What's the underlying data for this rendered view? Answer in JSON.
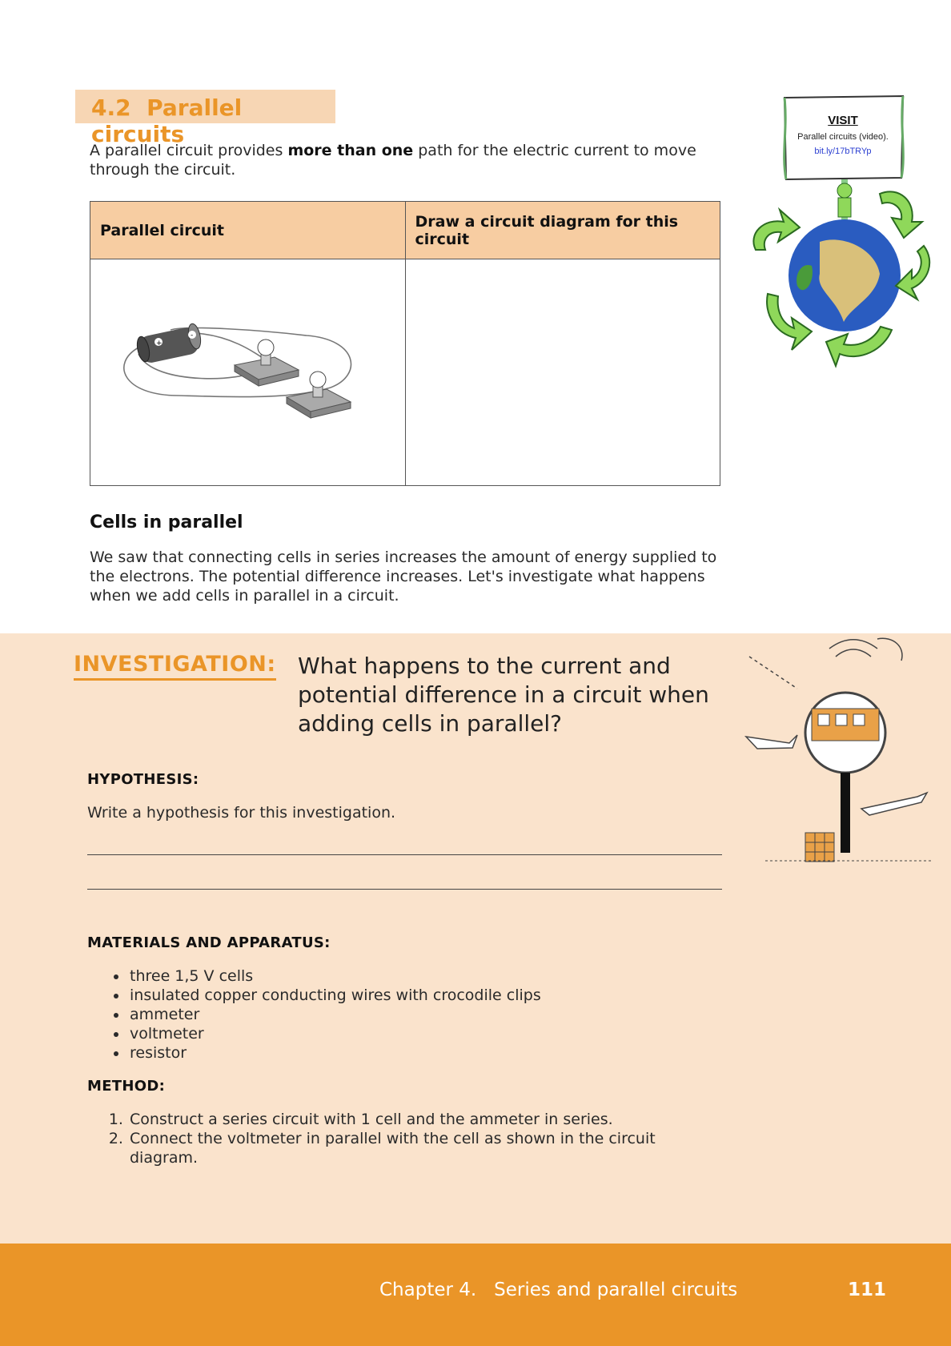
{
  "section": {
    "number": "4.2",
    "title": "Parallel circuits"
  },
  "intro": {
    "before": "A parallel circuit provides ",
    "bold": "more than one",
    "after": " path for the electric current to move through the circuit."
  },
  "table": {
    "col1_header": "Parallel circuit",
    "col2_header": "Draw a circuit diagram for this circuit"
  },
  "visit": {
    "label": "VISIT",
    "text": "Parallel circuits (video).",
    "link": "bit.ly/17bTRYp"
  },
  "cells_section": {
    "heading": "Cells in parallel",
    "paragraph": "We saw that connecting cells in series increases the amount of energy supplied to the electrons. The potential difference increases. Let's investigate what happens when we add cells in parallel in a circuit."
  },
  "investigation": {
    "label": "INVESTIGATION:",
    "question": "What happens to the current and potential difference in a circuit when adding cells in parallel?",
    "hypothesis_heading": "HYPOTHESIS:",
    "hypothesis_prompt": "Write a hypothesis for this investigation.",
    "materials_heading": "MATERIALS AND APPARATUS:",
    "materials": [
      "three 1,5 V cells",
      "insulated copper conducting wires with crocodile clips",
      "ammeter",
      "voltmeter",
      "resistor"
    ],
    "method_heading": "METHOD:",
    "method": [
      "Construct a series circuit with 1 cell and the ammeter in series.",
      "Connect the voltmeter in parallel with the cell as shown in the circuit diagram."
    ]
  },
  "footer": {
    "chapter": "Chapter 4.   Series and parallel circuits",
    "page": "111"
  },
  "colors": {
    "accent": "#ea9528",
    "heading_bg": "#f7d6b4",
    "table_header": "#f7cda2",
    "investigation_bg": "#fae3cc"
  }
}
